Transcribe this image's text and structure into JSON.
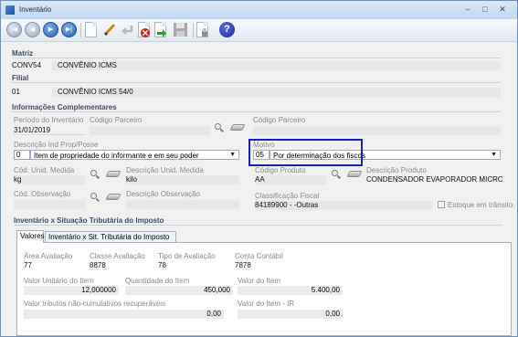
{
  "window": {
    "title": "Inventário",
    "minimize": "–",
    "maximize": "□",
    "close": "✕"
  },
  "toolbar": {
    "icons": [
      "first-icon",
      "prev-icon",
      "next-icon",
      "last-icon",
      "new-icon",
      "edit-icon",
      "undo-icon",
      "delete-icon",
      "confirm-icon",
      "save-icon",
      "print-icon",
      "help-icon"
    ]
  },
  "matriz": {
    "heading": "Matriz",
    "code": "CONV54",
    "name": "CONVÊNIO ICMS"
  },
  "filial": {
    "heading": "Filial",
    "code": "01",
    "name": "CONVÊNIO ICMS 54/0"
  },
  "info": {
    "heading": "Informações Complementares",
    "periodo_label": "Período do Inventário",
    "periodo_value": "31/01/2019",
    "cod_parceiro_label": "Código Parceiro",
    "cod_parceiro_value": "",
    "cod_parceiro2_label": "Código Parceiro",
    "cod_parceiro2_value": "",
    "desc_ind_label": "Descrição Ind Prop/Posse",
    "desc_ind_code": "0",
    "desc_ind_text": "Item de propriedade do informante e em seu poder",
    "motivo_label": "Motivo",
    "motivo_code": "05",
    "motivo_text": "Por determinação dos fiscos",
    "cod_unid_label": "Cód. Unid. Medida",
    "cod_unid_value": "kg",
    "desc_unid_label": "Descrição Unid. Medida",
    "desc_unid_value": "kilo",
    "cod_prod_label": "Código Produto",
    "cod_prod_value": "AA",
    "desc_prod_label": "Descrição Produto",
    "desc_prod_value": "CONDENSADOR EVAPORADOR MICROCANAL",
    "cod_obs_label": "Cód. Observação",
    "cod_obs_value": "",
    "desc_obs_label": "Descrição Observação",
    "desc_obs_value": "",
    "class_fiscal_label": "Classificação Fiscal",
    "class_fiscal_value": "84189900 - -Outras",
    "estoque_label": "Estoque em trânsito"
  },
  "inv": {
    "heading": "Inventário x Situação Tributária do Imposto",
    "tabs": [
      "Valores",
      "Inventário x Sit. Tributária do Imposto"
    ],
    "area_label": "Área Avaliação",
    "area_value": "77",
    "classe_label": "Classe Avaliação",
    "classe_value": "8878",
    "tipo_label": "Tipo de Avaliação",
    "tipo_value": "78",
    "conta_label": "Conta Contábil",
    "conta_value": "7878",
    "vunit_label": "Valor Unitário do Item",
    "vunit_value": "12,000000",
    "qtd_label": "Quantidade do Item",
    "qtd_value": "450,000",
    "vitem_label": "Valor do Item",
    "vitem_value": "5.400,00",
    "vtrib_label": "Valor tributos não-cumulativos recuperáveis",
    "vtrib_value": "0,00",
    "vir_label": "Valor do Item - IR",
    "vir_value": "0,00"
  }
}
